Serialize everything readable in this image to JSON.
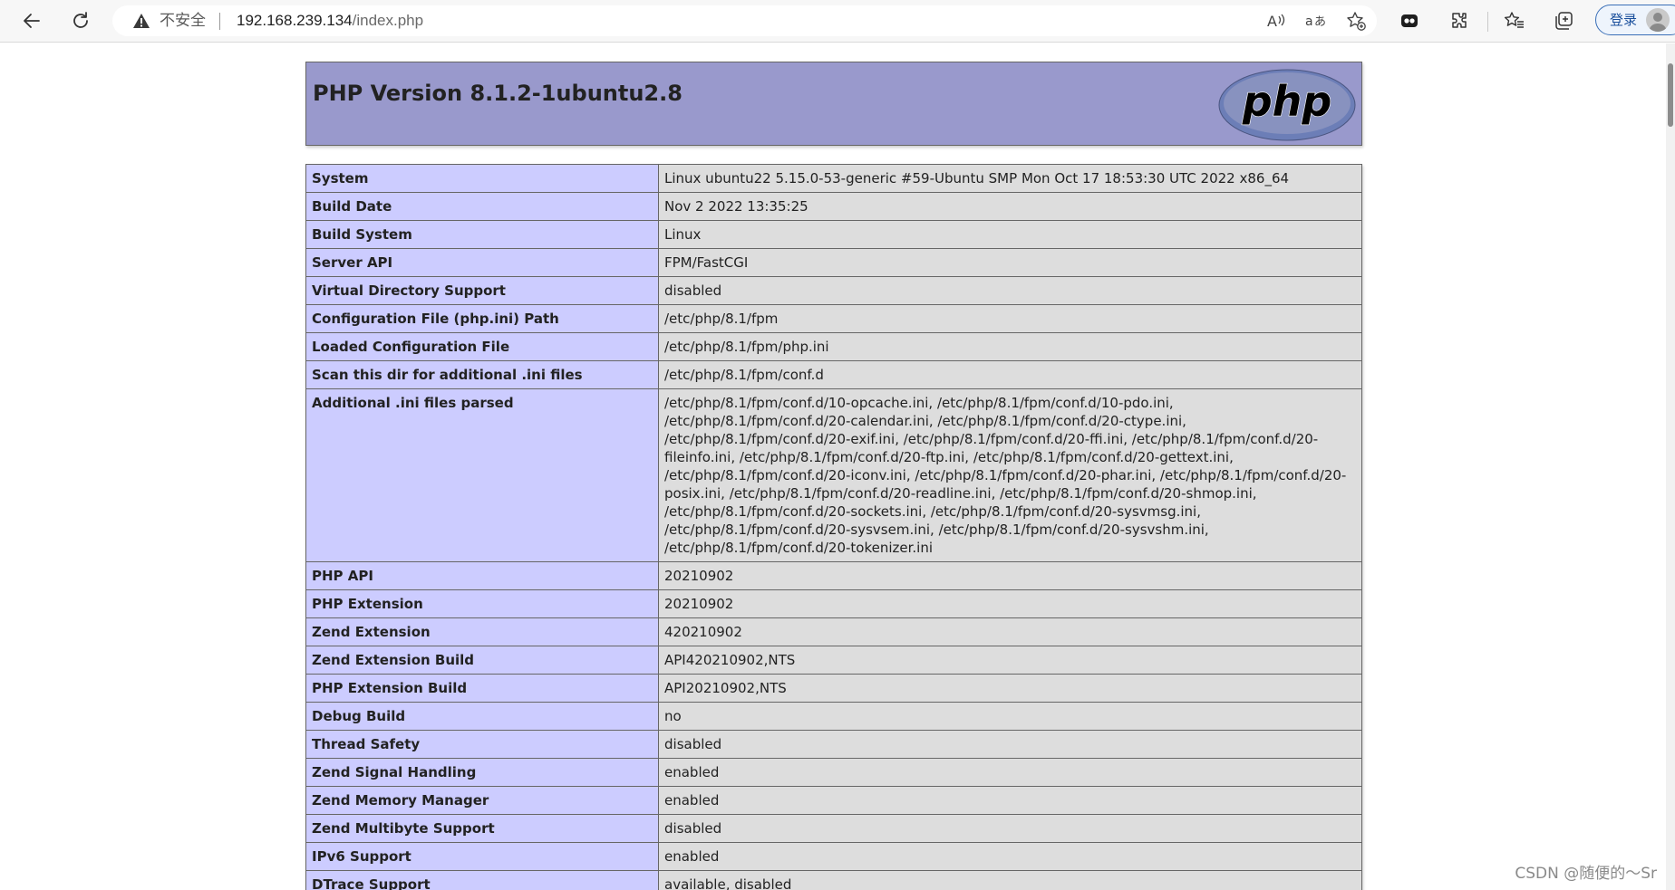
{
  "browser": {
    "security_label": "不安全",
    "url_host": "192.168.239.134",
    "url_path": "/index.php",
    "login_label": "登录",
    "icons": [
      "back-icon",
      "refresh-icon",
      "warning-icon",
      "read-aloud-icon",
      "translate-icon",
      "add-favorite-icon",
      "extension-icon",
      "puzzle-icon",
      "favorites-icon",
      "collections-icon"
    ]
  },
  "php_header": {
    "title": "PHP Version 8.1.2-1ubuntu2.8",
    "logo_text": "php"
  },
  "rows": [
    {
      "label": "System",
      "value": "Linux ubuntu22 5.15.0-53-generic #59-Ubuntu SMP Mon Oct 17 18:53:30 UTC 2022 x86_64"
    },
    {
      "label": "Build Date",
      "value": "Nov 2 2022 13:35:25"
    },
    {
      "label": "Build System",
      "value": "Linux"
    },
    {
      "label": "Server API",
      "value": "FPM/FastCGI"
    },
    {
      "label": "Virtual Directory Support",
      "value": "disabled"
    },
    {
      "label": "Configuration File (php.ini) Path",
      "value": "/etc/php/8.1/fpm"
    },
    {
      "label": "Loaded Configuration File",
      "value": "/etc/php/8.1/fpm/php.ini"
    },
    {
      "label": "Scan this dir for additional .ini files",
      "value": "/etc/php/8.1/fpm/conf.d"
    },
    {
      "label": "Additional .ini files parsed",
      "value": "/etc/php/8.1/fpm/conf.d/10-opcache.ini, /etc/php/8.1/fpm/conf.d/10-pdo.ini,\n/etc/php/8.1/fpm/conf.d/20-calendar.ini, /etc/php/8.1/fpm/conf.d/20-ctype.ini,\n/etc/php/8.1/fpm/conf.d/20-exif.ini, /etc/php/8.1/fpm/conf.d/20-ffi.ini, /etc/php/8.1/fpm/conf.d/20-\nfileinfo.ini, /etc/php/8.1/fpm/conf.d/20-ftp.ini, /etc/php/8.1/fpm/conf.d/20-gettext.ini,\n/etc/php/8.1/fpm/conf.d/20-iconv.ini, /etc/php/8.1/fpm/conf.d/20-phar.ini, /etc/php/8.1/fpm/conf.d/20-\nposix.ini, /etc/php/8.1/fpm/conf.d/20-readline.ini, /etc/php/8.1/fpm/conf.d/20-shmop.ini,\n/etc/php/8.1/fpm/conf.d/20-sockets.ini, /etc/php/8.1/fpm/conf.d/20-sysvmsg.ini,\n/etc/php/8.1/fpm/conf.d/20-sysvsem.ini, /etc/php/8.1/fpm/conf.d/20-sysvshm.ini,\n/etc/php/8.1/fpm/conf.d/20-tokenizer.ini"
    },
    {
      "label": "PHP API",
      "value": "20210902"
    },
    {
      "label": "PHP Extension",
      "value": "20210902"
    },
    {
      "label": "Zend Extension",
      "value": "420210902"
    },
    {
      "label": "Zend Extension Build",
      "value": "API420210902,NTS"
    },
    {
      "label": "PHP Extension Build",
      "value": "API20210902,NTS"
    },
    {
      "label": "Debug Build",
      "value": "no"
    },
    {
      "label": "Thread Safety",
      "value": "disabled"
    },
    {
      "label": "Zend Signal Handling",
      "value": "enabled"
    },
    {
      "label": "Zend Memory Manager",
      "value": "enabled"
    },
    {
      "label": "Zend Multibyte Support",
      "value": "disabled"
    },
    {
      "label": "IPv6 Support",
      "value": "enabled"
    },
    {
      "label": "DTrace Support",
      "value": "available, disabled"
    }
  ],
  "watermark": "CSDN @随便的～Sr",
  "colors": {
    "header_bg": "#9999cc",
    "label_bg": "#ccccff",
    "value_bg": "#dddddd",
    "border": "#666666"
  }
}
